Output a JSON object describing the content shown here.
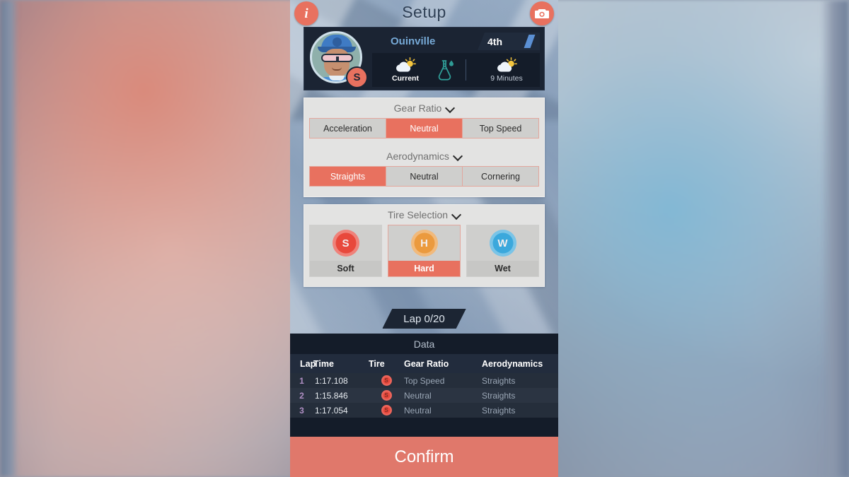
{
  "theme": {
    "accent": "#e8715f",
    "panel_dark": "#1b2433",
    "card_bg": "#e3e3e2",
    "confirm_bg": "#e0786b",
    "position_blue": "#5b90d4",
    "driver_name_blue": "#76a9d6"
  },
  "topbar": {
    "title": "Setup",
    "info_icon": "info-icon",
    "info_glyph": "i",
    "camera_icon": "camera-icon"
  },
  "driver": {
    "name": "Ouinville",
    "position": "4th",
    "tire_badge": "S",
    "avatar_icon": "driver-avatar"
  },
  "weather": {
    "current": {
      "label": "Current",
      "icon": "sun-behind-cloud-icon"
    },
    "flask": {
      "icon": "flask-droplet-icon"
    },
    "future": {
      "label": "9 Minutes",
      "icon": "sun-behind-cloud-icon"
    }
  },
  "setup": {
    "gear_ratio": {
      "title": "Gear Ratio",
      "chevron": "chevron-down-icon",
      "options": [
        "Acceleration",
        "Neutral",
        "Top Speed"
      ],
      "selected": "Neutral"
    },
    "aerodynamics": {
      "title": "Aerodynamics",
      "chevron": "chevron-down-icon",
      "options": [
        "Straights",
        "Neutral",
        "Cornering"
      ],
      "selected": "Straights"
    },
    "tire_selection": {
      "title": "Tire Selection",
      "chevron": "chevron-down-icon",
      "selected": "Hard",
      "options": [
        {
          "label": "Soft",
          "letter": "S",
          "color": "#e8483c"
        },
        {
          "label": "Hard",
          "letter": "H",
          "color": "#eb9a3e"
        },
        {
          "label": "Wet",
          "letter": "W",
          "color": "#3ba8dc"
        }
      ]
    }
  },
  "lap_banner": {
    "text": "Lap 0/20"
  },
  "data": {
    "title": "Data",
    "columns": [
      "Lap",
      "Time",
      "Tire",
      "Gear Ratio",
      "Aerodynamics"
    ],
    "rows": [
      {
        "lap": "1",
        "time": "1:17.108",
        "tire": "S",
        "tire_color": "#e8483c",
        "gear": "Top Speed",
        "aero": "Straights"
      },
      {
        "lap": "2",
        "time": "1:15.846",
        "tire": "S",
        "tire_color": "#e8483c",
        "gear": "Neutral",
        "aero": "Straights"
      },
      {
        "lap": "3",
        "time": "1:17.054",
        "tire": "S",
        "tire_color": "#e8483c",
        "gear": "Neutral",
        "aero": "Straights"
      }
    ]
  },
  "confirm": {
    "label": "Confirm"
  }
}
